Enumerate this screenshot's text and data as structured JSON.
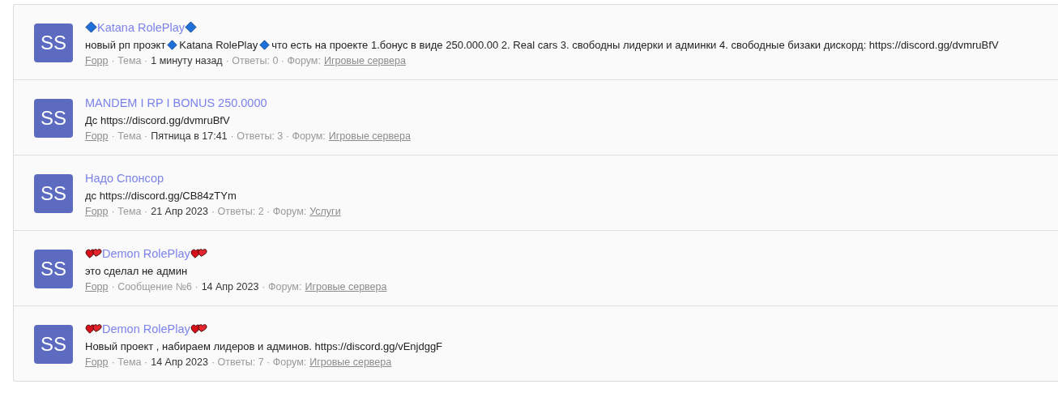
{
  "results": [
    {
      "avatar": "SS",
      "title": [
        {
          "kind": "diamond"
        },
        {
          "kind": "text",
          "text": "Katana RolePlay"
        },
        {
          "kind": "diamond"
        }
      ],
      "body": [
        {
          "kind": "text",
          "text": "новый рп проэкт"
        },
        {
          "kind": "diamond"
        },
        {
          "kind": "text",
          "text": "Katana RolePlay"
        },
        {
          "kind": "diamond"
        },
        {
          "kind": "text",
          "text": "что есть на проекте 1.бонус в виде 250.000.00 2. Real cars 3. свободны лидерки и админки 4. свободные бизаки дискорд: https://discord.gg/dvmruBfV"
        }
      ],
      "meta": [
        {
          "kind": "link",
          "text": "Fopp"
        },
        {
          "kind": "muted",
          "text": "· Тема ·"
        },
        {
          "kind": "date",
          "text": "1 минуту назад"
        },
        {
          "kind": "muted",
          "text": "· Ответы: 0 · Форум:"
        },
        {
          "kind": "link",
          "text": "Игровые сервера"
        }
      ]
    },
    {
      "avatar": "SS",
      "title": [
        {
          "kind": "text",
          "text": "MANDEM I RP I BONUS 250.0000"
        }
      ],
      "body": [
        {
          "kind": "text",
          "text": "Дс https://discord.gg/dvmruBfV"
        }
      ],
      "meta": [
        {
          "kind": "link",
          "text": "Fopp"
        },
        {
          "kind": "muted",
          "text": "· Тема ·"
        },
        {
          "kind": "date",
          "text": "Пятница в 17:41"
        },
        {
          "kind": "muted",
          "text": "· Ответы: 3 · Форум:"
        },
        {
          "kind": "link",
          "text": "Игровые сервера"
        }
      ]
    },
    {
      "avatar": "SS",
      "title": [
        {
          "kind": "text",
          "text": "Надо Спонсор"
        }
      ],
      "body": [
        {
          "kind": "text",
          "text": "дс https://discord.gg/CB84zTYm"
        }
      ],
      "meta": [
        {
          "kind": "link",
          "text": "Fopp"
        },
        {
          "kind": "muted",
          "text": "· Тема ·"
        },
        {
          "kind": "date",
          "text": "21 Апр 2023"
        },
        {
          "kind": "muted",
          "text": "· Ответы: 2 · Форум:"
        },
        {
          "kind": "link",
          "text": "Услуги"
        }
      ]
    },
    {
      "avatar": "SS",
      "title": [
        {
          "kind": "hearts"
        },
        {
          "kind": "text",
          "text": "Demon RolePlay"
        },
        {
          "kind": "hearts"
        }
      ],
      "body": [
        {
          "kind": "text",
          "text": "это сделал не админ"
        }
      ],
      "meta": [
        {
          "kind": "link",
          "text": "Fopp"
        },
        {
          "kind": "muted",
          "text": "· Сообщение №6 ·"
        },
        {
          "kind": "date",
          "text": "14 Апр 2023"
        },
        {
          "kind": "muted",
          "text": "· Форум:"
        },
        {
          "kind": "link",
          "text": "Игровые сервера"
        }
      ]
    },
    {
      "avatar": "SS",
      "title": [
        {
          "kind": "hearts"
        },
        {
          "kind": "text",
          "text": "Demon RolePlay"
        },
        {
          "kind": "hearts"
        }
      ],
      "body": [
        {
          "kind": "text",
          "text": "Новый проект , набираем лидеров и админов. https://discord.gg/vEnjdggF"
        }
      ],
      "meta": [
        {
          "kind": "link",
          "text": "Fopp"
        },
        {
          "kind": "muted",
          "text": "· Тема ·"
        },
        {
          "kind": "date",
          "text": "14 Апр 2023"
        },
        {
          "kind": "muted",
          "text": "· Ответы: 7 · Форум:"
        },
        {
          "kind": "link",
          "text": "Игровые сервера"
        }
      ]
    }
  ]
}
